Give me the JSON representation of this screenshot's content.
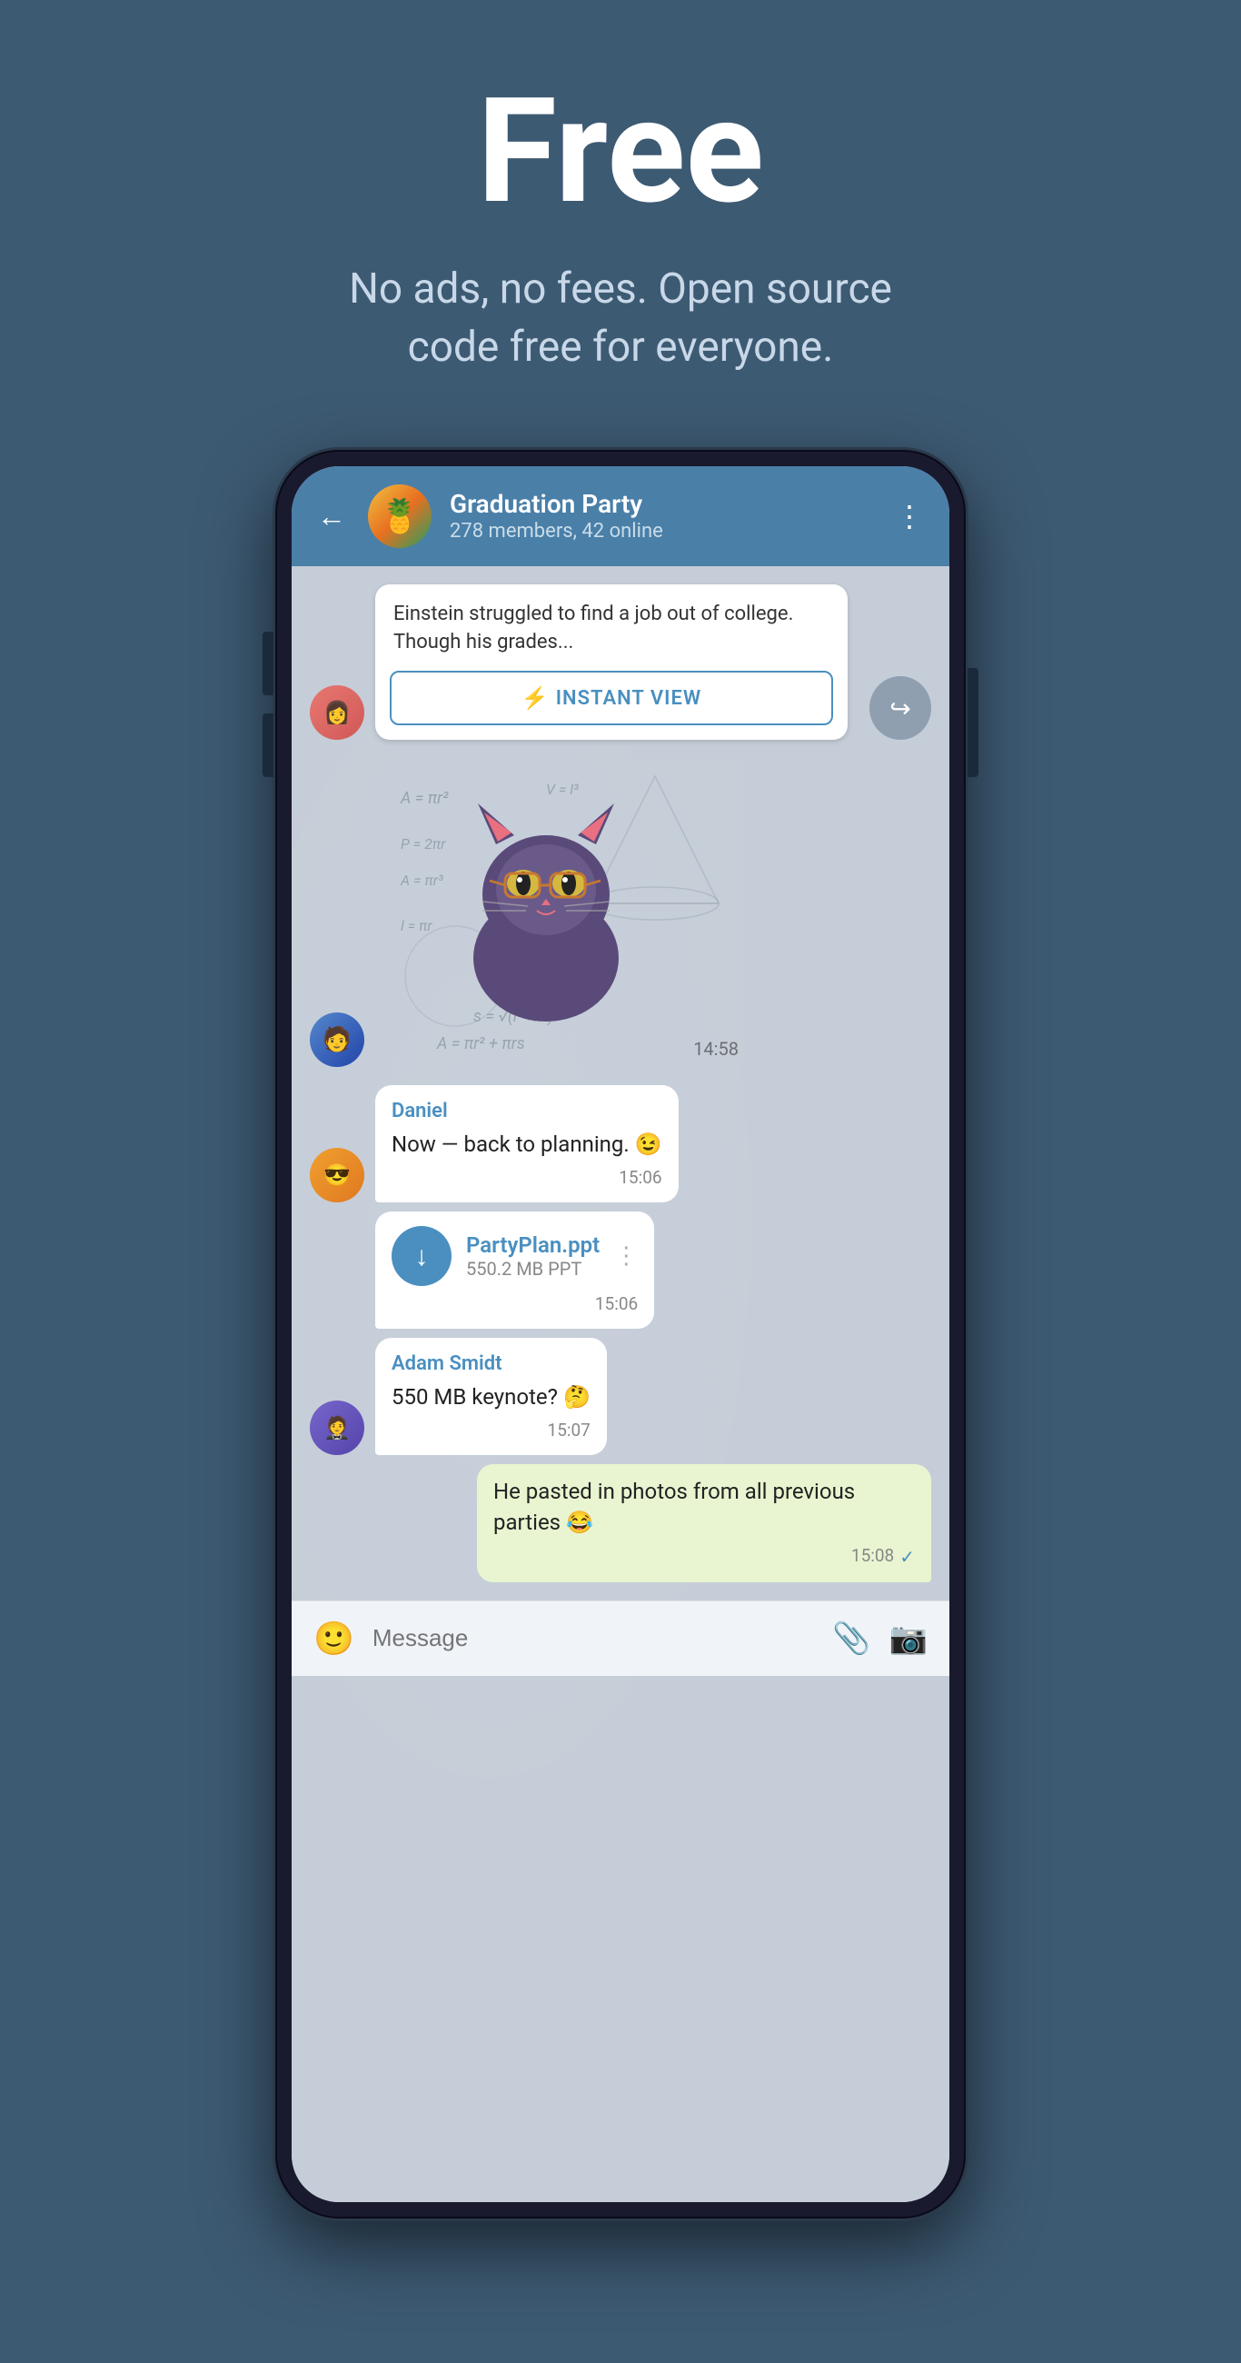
{
  "hero": {
    "title": "Free",
    "subtitle": "No ads, no fees. Open source code free for everyone."
  },
  "phone": {
    "header": {
      "group_name": "Graduation Party",
      "members": "278 members, 42 online",
      "back_label": "←",
      "more_label": "⋮"
    },
    "messages": [
      {
        "id": "iv-card",
        "type": "instant_view",
        "text": "Einstein struggled to find a job out of college. Though his grades...",
        "button_label": "INSTANT VIEW",
        "button_icon": "⚡"
      },
      {
        "id": "sticker",
        "type": "sticker",
        "time": "14:58"
      },
      {
        "id": "msg-daniel",
        "type": "text",
        "sender": "Daniel",
        "text": "Now — back to planning. 😉",
        "time": "15:06"
      },
      {
        "id": "msg-file",
        "type": "file",
        "file_name": "PartyPlan.ppt",
        "file_size": "550.2 MB PPT",
        "time": "15:06"
      },
      {
        "id": "msg-adam",
        "type": "text",
        "sender": "Adam Smidt",
        "text": "550 MB keynote? 🤔",
        "time": "15:07"
      },
      {
        "id": "msg-self",
        "type": "text_self",
        "text": "He pasted in photos from all previous parties 😂",
        "time": "15:08",
        "check": "✓"
      }
    ],
    "input": {
      "placeholder": "Message"
    }
  }
}
